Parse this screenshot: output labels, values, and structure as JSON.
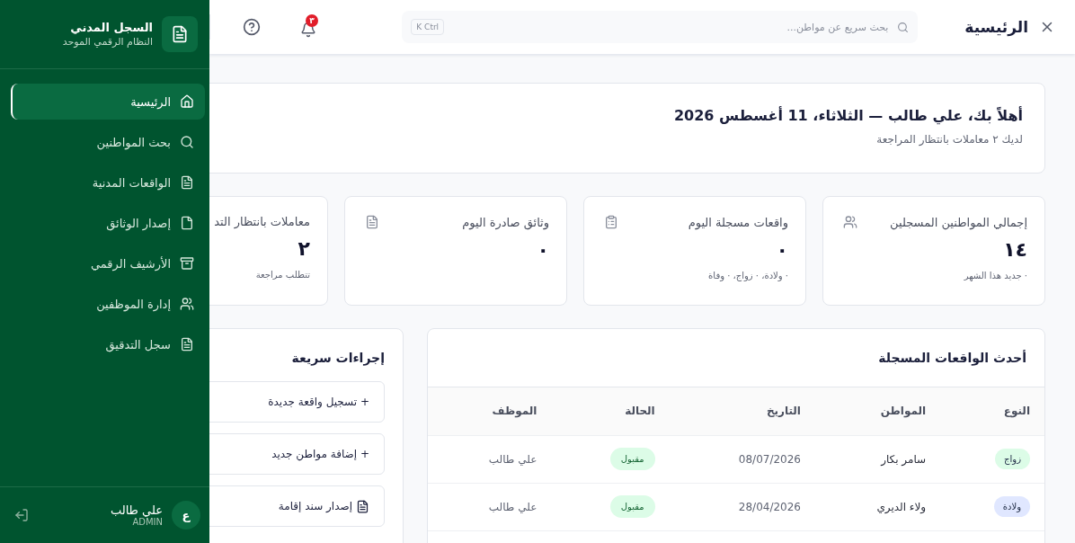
{
  "sidebar": {
    "title": "السجل المدني",
    "subtitle": "النظام الرقمي الموحد",
    "items": [
      {
        "label": "الرئيسية",
        "kind": "home",
        "selected": true
      },
      {
        "label": "بحث المواطنين",
        "kind": "search",
        "selected": false
      },
      {
        "label": "الواقعات المدنية",
        "kind": "doc",
        "selected": false
      },
      {
        "label": "إصدار الوثائق",
        "kind": "file",
        "selected": false
      },
      {
        "label": "الأرشيف الرقمي",
        "kind": "archive",
        "selected": false
      },
      {
        "label": "إدارة الموظفين",
        "kind": "users",
        "selected": false
      },
      {
        "label": "سجل التدقيق",
        "kind": "doc",
        "selected": false
      }
    ],
    "user": {
      "avatar": "ع",
      "name": "علي طالب",
      "role": "ADMIN"
    }
  },
  "header": {
    "title": "الرئيسية",
    "search": {
      "placeholder": "بحث سريع عن مواطن...",
      "shortcut": "K Ctrl"
    },
    "notifications": "٣"
  },
  "welcome": {
    "title": "أهلاً بك، علي طالب — الثلاثاء، 11 أغسطس 2026",
    "subtitle": "لديك ٢ معاملات بانتظار المراجعة"
  },
  "stats": [
    {
      "title": "إجمالي المواطنين المسجلين",
      "kind": "users",
      "value": "١٤",
      "note": "· جديد هذا الشهر"
    },
    {
      "title": "واقعات مسجلة اليوم",
      "kind": "clipboard",
      "value": "٠",
      "note": "· ولادة، · زواج، · وفاة"
    },
    {
      "title": "وثائق صادرة اليوم",
      "kind": "doc",
      "value": "٠"
    },
    {
      "title": "معاملات بانتظار التد",
      "value": "٢",
      "note": "تتطلب مراجعة"
    }
  ],
  "events": {
    "title": "أحدث الواقعات المسجلة",
    "columns": [
      "النوع",
      "المواطن",
      "التاريخ",
      "الحالة",
      "الموظف"
    ],
    "rows": [
      {
        "type": "زواج",
        "color": "#dcfce7",
        "citizen": "سامر بكار",
        "date": "08/07/2026",
        "status": "مقبول",
        "employee": "علي طالب"
      },
      {
        "type": "ولادة",
        "color": "#e0e7ff",
        "citizen": "ولاء الديري",
        "date": "28/04/2026",
        "status": "مقبول",
        "employee": "علي طالب"
      }
    ]
  },
  "quick_actions": {
    "title": "إجراءات سريعة",
    "items": [
      {
        "label": "+ تسجيل واقعة جديدة",
        "kind": "text"
      },
      {
        "label": "+ إضافة مواطن جديد",
        "kind": "text"
      },
      {
        "label": "إصدار سند إقامة",
        "kind": "doc"
      }
    ]
  }
}
